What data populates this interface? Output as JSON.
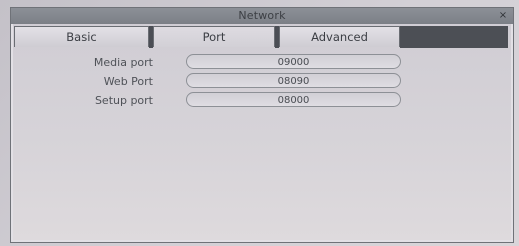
{
  "window": {
    "title": "Network",
    "close_glyph": "×"
  },
  "tabs": [
    {
      "label": "Basic",
      "active": false
    },
    {
      "label": "Port",
      "active": true
    },
    {
      "label": "Advanced",
      "active": false
    }
  ],
  "fields": [
    {
      "label": "Media port",
      "value": "09000"
    },
    {
      "label": "Web Port",
      "value": "08090"
    },
    {
      "label": "Setup port",
      "value": "08000"
    }
  ]
}
